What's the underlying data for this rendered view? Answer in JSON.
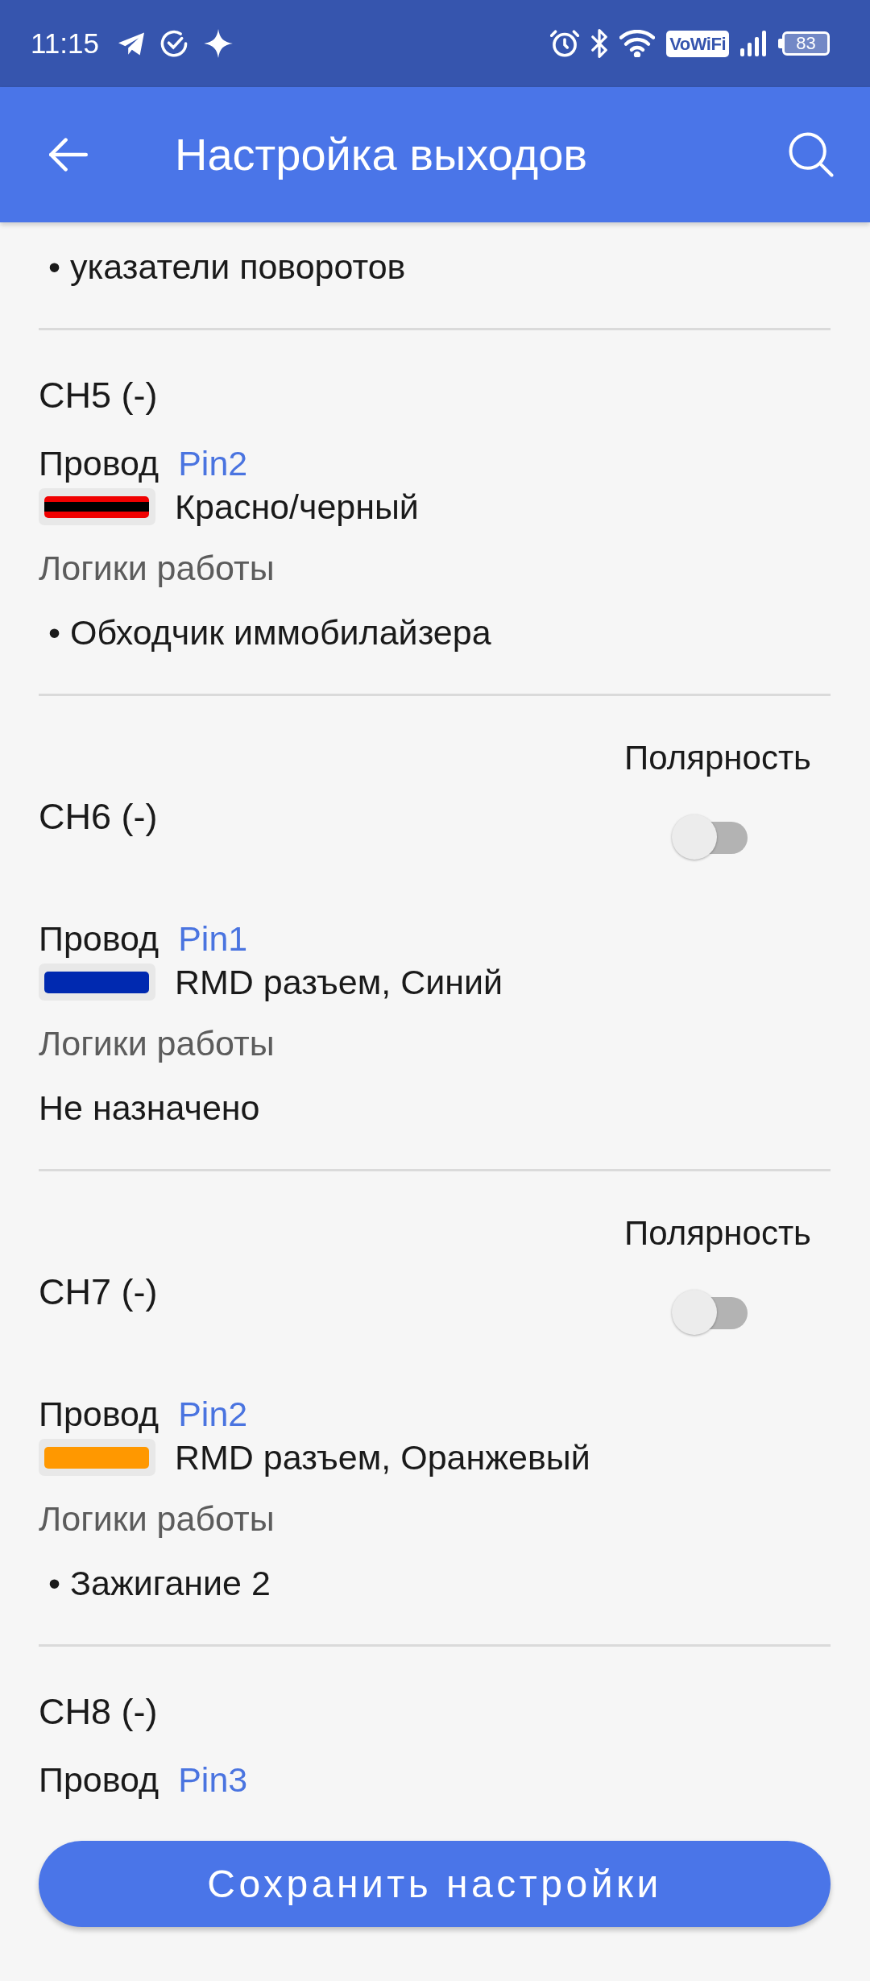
{
  "status_bar": {
    "time": "11:15",
    "vowifi": "VoWiFi",
    "battery": "83"
  },
  "app_bar": {
    "title": "Настройка выходов"
  },
  "outputs": [
    {
      "logic": [
        {
          "kind": "bullet",
          "text": "• указатели поворотов"
        }
      ]
    },
    {
      "title": "CH5 (-)",
      "wire": {
        "label": "Провод",
        "pin": "Pin2",
        "name": "Красно/черный",
        "color": "#f00000",
        "stripe": {
          "color": "#000000"
        }
      },
      "logic_label": "Логики работы",
      "logic": [
        {
          "kind": "bullet",
          "text": "• Обходчик иммобилайзера"
        }
      ]
    },
    {
      "title": "CH6 (-)",
      "polarity": {
        "label": "Полярность",
        "on": false
      },
      "wire": {
        "label": "Провод",
        "pin": "Pin1",
        "name": "RMD разъем, Синий",
        "color": "#0029b0"
      },
      "logic_label": "Логики работы",
      "logic": [
        {
          "kind": "plain",
          "text": "Не назначено"
        }
      ]
    },
    {
      "title": "CH7 (-)",
      "polarity": {
        "label": "Полярность",
        "on": false
      },
      "wire": {
        "label": "Провод",
        "pin": "Pin2",
        "name": "RMD разъем, Оранжевый",
        "color": "#ff9800"
      },
      "logic_label": "Логики работы",
      "logic": [
        {
          "kind": "bullet",
          "text": "• Зажигание 2"
        }
      ]
    },
    {
      "title": "CH8 (-)",
      "wire": {
        "label": "Провод",
        "pin": "Pin3"
      }
    }
  ],
  "save_button": {
    "label": "Сохранить настройки"
  }
}
